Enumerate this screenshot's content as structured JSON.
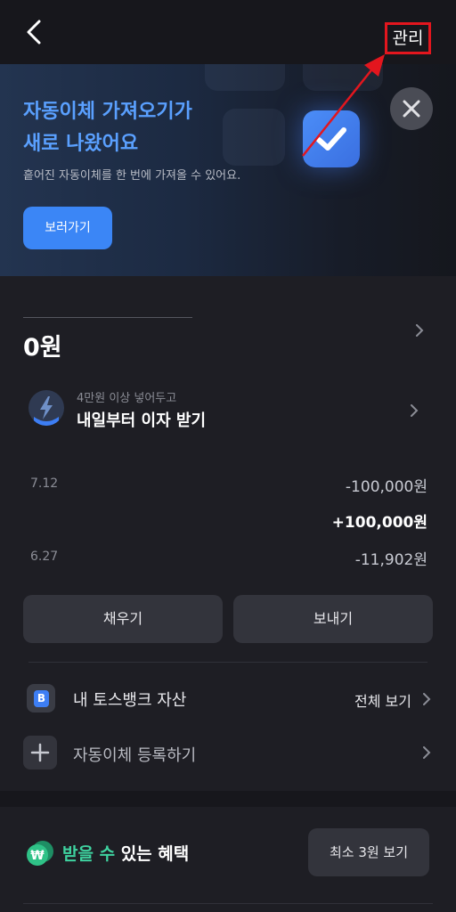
{
  "header": {
    "manage_label": "관리"
  },
  "banner": {
    "title_line1": "자동이체 가져오기가",
    "title_line2": "새로 나왔어요",
    "description": "흩어진 자동이체를 한 번에 가져올 수 있어요.",
    "cta_label": "보러가기"
  },
  "account": {
    "balance": "0원",
    "interest": {
      "subtitle": "4만원 이상 넣어두고",
      "title": "내일부터 이자 받기"
    },
    "transactions": [
      {
        "date": "7.12",
        "amount": "-100,000원"
      },
      {
        "date": "",
        "amount": "+100,000원"
      },
      {
        "date": "6.27",
        "amount": "-11,902원"
      }
    ],
    "fill_label": "채우기",
    "send_label": "보내기"
  },
  "assets": {
    "badge_letter": "B",
    "label": "내 토스뱅크 자산",
    "view_all": "전체 보기"
  },
  "autopay": {
    "label": "자동이체 등록하기"
  },
  "benefit": {
    "coin_symbol": "₩",
    "text_highlight1": "받을",
    "text_space": " ",
    "text_highlight2": "수",
    "text_rest": " 있는 혜택",
    "button_label": "최소 3원 보기"
  },
  "colors": {
    "accent_blue": "#3b86f6",
    "highlight_green": "#3fd3a0",
    "annotation_red": "#e3161e",
    "background": "#17171c"
  },
  "icons": [
    "back-chevron-icon",
    "close-icon",
    "check-icon",
    "chevron-right-icon",
    "bolt-icon",
    "plus-icon",
    "won-coin-icon"
  ]
}
